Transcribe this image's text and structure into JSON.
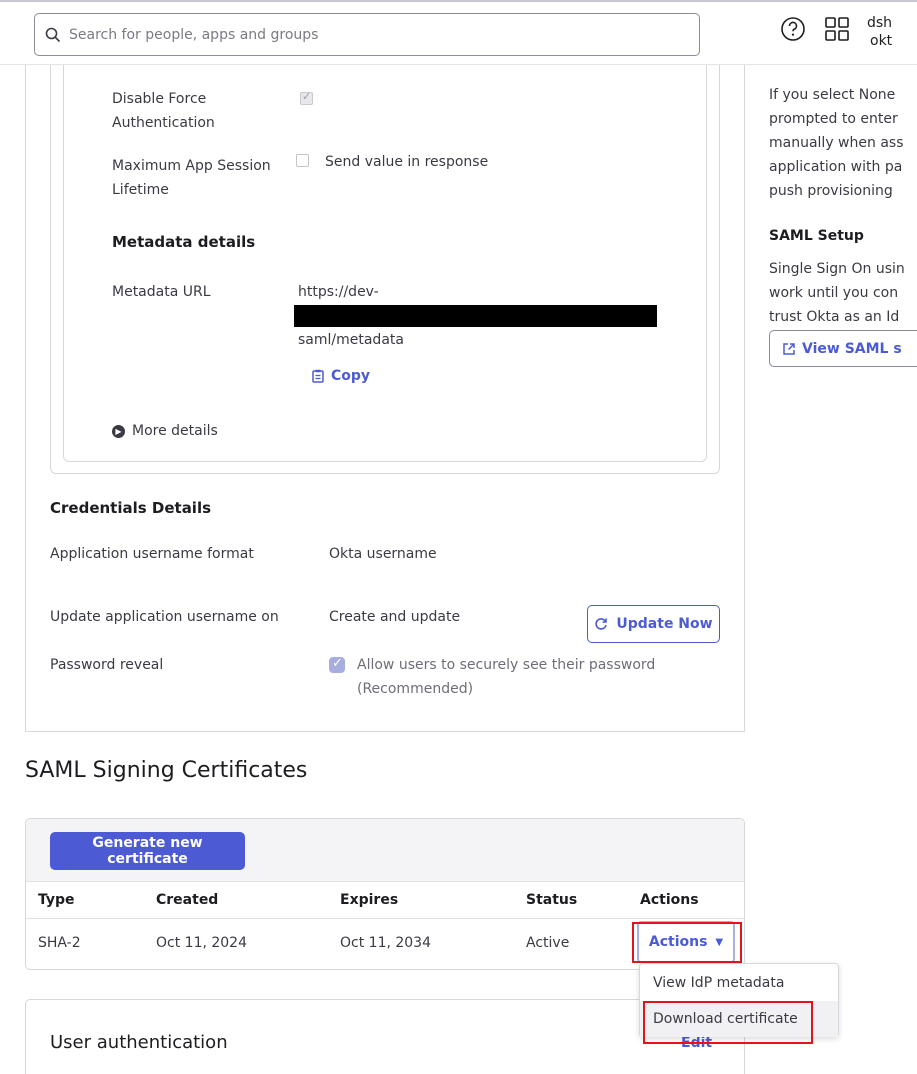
{
  "header": {
    "search_placeholder": "Search for people, apps and groups",
    "user_name": "dsh",
    "user_org": "okt"
  },
  "sign_on": {
    "disable_force_auth_label_1": "Disable Force",
    "disable_force_auth_label_2": "Authentication",
    "disable_force_auth_checked": true,
    "max_session_label_1": "Maximum App Session",
    "max_session_label_2": "Lifetime",
    "send_value_label": "Send value in response",
    "metadata_heading": "Metadata details",
    "metadata_url_label": "Metadata URL",
    "metadata_url_start": "https://dev-",
    "metadata_url_end": "saml/metadata",
    "copy_label": "Copy",
    "more_details_label": "More details"
  },
  "credentials": {
    "heading": "Credentials Details",
    "username_format_label": "Application username format",
    "username_format_value": "Okta username",
    "update_on_label": "Update application username on",
    "update_on_value": "Create and update",
    "update_now_label": "Update Now",
    "password_reveal_label": "Password reveal",
    "password_reveal_text_1": "Allow users to securely see their password",
    "password_reveal_text_2": "(Recommended)"
  },
  "certificates": {
    "section_title": "SAML Signing Certificates",
    "generate_label": "Generate new certificate",
    "columns": [
      "Type",
      "Created",
      "Expires",
      "Status",
      "Actions"
    ],
    "rows": [
      {
        "type": "SHA-2",
        "created": "Oct 11, 2024",
        "expires": "Oct 11, 2034",
        "status": "Active",
        "actions": "Actions"
      }
    ],
    "dropdown": [
      "View IdP metadata",
      "Download certificate"
    ]
  },
  "user_auth": {
    "title": "User authentication",
    "edit_label": "Edit"
  },
  "right_panel": {
    "lines_1": [
      "If you select None",
      "prompted to enter",
      "manually when ass",
      "application with pa",
      "push provisioning"
    ],
    "saml_setup_title": "SAML Setup",
    "lines_2": [
      "Single Sign On usin",
      "work until you con",
      "trust Okta as an Id"
    ],
    "view_saml_label": "View SAML s"
  },
  "colors": {
    "accent": "#4c5bd4",
    "highlight_red": "#e3141c"
  }
}
